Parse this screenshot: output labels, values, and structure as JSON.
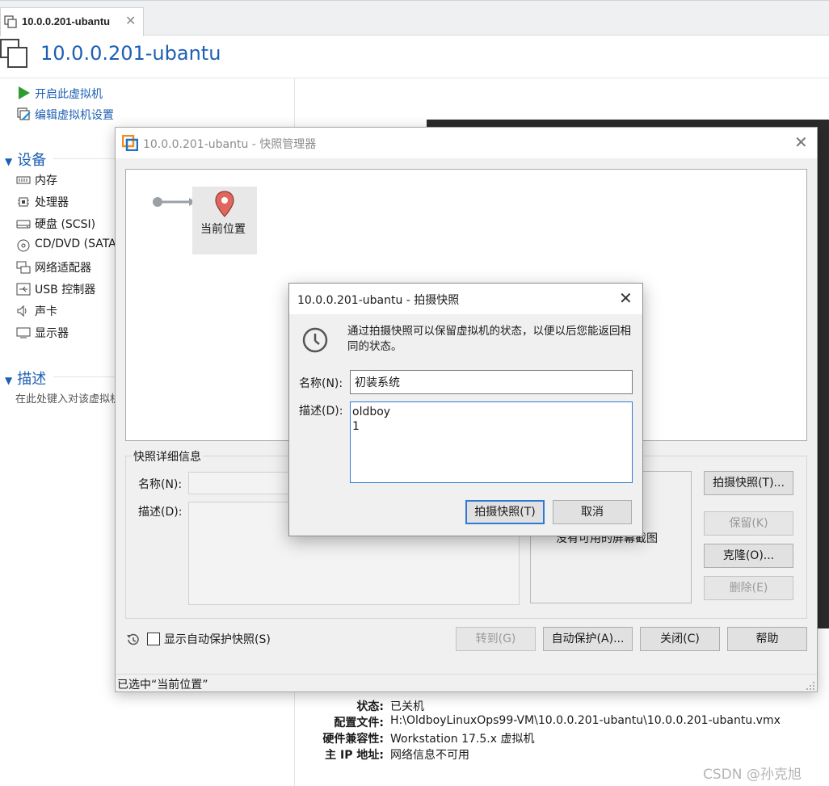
{
  "tab": {
    "label": "10.0.0.201-ubantu"
  },
  "vm": {
    "title": "10.0.0.201-ubantu",
    "actions": {
      "power_on": "开启此虚拟机",
      "edit_settings": "编辑虚拟机设置"
    }
  },
  "devices": {
    "section_title": "设备",
    "items": [
      "内存",
      "处理器",
      "硬盘 (SCSI)",
      "CD/DVD (SATA)",
      "网络适配器",
      "USB 控制器",
      "声卡",
      "显示器"
    ]
  },
  "description": {
    "section_title": "描述",
    "hint": "在此处键入对该虚拟机的描述。"
  },
  "details": {
    "rows": [
      {
        "label": "状态:",
        "value": "已关机"
      },
      {
        "label": "配置文件:",
        "value": "H:\\OldboyLinuxOps99-VM\\10.0.0.201-ubantu\\10.0.0.201-ubantu.vmx"
      },
      {
        "label": "硬件兼容性:",
        "value": "Workstation 17.5.x 虚拟机"
      },
      {
        "label": "主 IP 地址:",
        "value": "网络信息不可用"
      }
    ]
  },
  "watermark": "CSDN @孙克旭",
  "snapshot_manager": {
    "title": "10.0.0.201-ubantu - 快照管理器",
    "current_node_label": "当前位置",
    "details_group_title": "快照详细信息",
    "name_label": "名称(N):",
    "description_label": "描述(D):",
    "no_screenshot_text": "没有可用的屏幕截图",
    "buttons": {
      "take_snapshot": "拍摄快照(T)...",
      "keep": "保留(K)",
      "clone": "克隆(O)...",
      "delete": "删除(E)",
      "goto": "转到(G)",
      "autoprotect": "自动保护(A)...",
      "close": "关闭(C)",
      "help": "帮助"
    },
    "show_autoprotect_label": "显示自动保护快照(S)",
    "status_text": "已选中“当前位置”"
  },
  "take_snapshot_dialog": {
    "title": "10.0.0.201-ubantu - 拍摄快照",
    "info_text": "通过拍摄快照可以保留虚拟机的状态，以便以后您能返回相同的状态。",
    "name_label": "名称(N):",
    "name_value": "初装系统",
    "description_label": "描述(D):",
    "description_value": "oldboy\n1",
    "take_button": "拍摄快照(T)",
    "cancel_button": "取消"
  },
  "colors": {
    "accent": "#1c5fb5",
    "play_green": "#2e9d2e",
    "pin_red": "#e0675e",
    "focus_blue": "#2f7ad6"
  }
}
